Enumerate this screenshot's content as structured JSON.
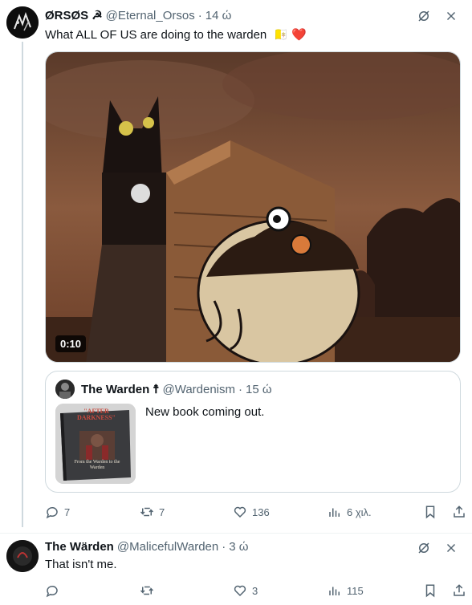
{
  "tweet1": {
    "display_name": "ØRSØS",
    "name_suffix": "☭",
    "handle": "@Eternal_Orsos",
    "separator": "·",
    "time": "14 ώ",
    "text": "What ALL OF US are doing to the warden",
    "emoji": "🇻🇦 ❤️",
    "media": {
      "duration": "0:10"
    },
    "quote": {
      "display_name": "The Warden",
      "name_suffix": "☨",
      "handle": "@Wardenism",
      "separator": "·",
      "time": "15 ώ",
      "text": "New book coming out.",
      "book_title": "\"AFTER DARKNESS\"",
      "book_subtitle": "From the Warden to the Warden"
    },
    "actions": {
      "replies": "7",
      "reposts": "7",
      "likes": "136",
      "views": "6 χιλ."
    }
  },
  "tweet2": {
    "display_name": "The Wärden",
    "handle": "@MalicefulWarden",
    "separator": "·",
    "time": "3 ώ",
    "text": "That isn't me.",
    "actions": {
      "replies": "",
      "reposts": "",
      "likes": "3",
      "views": "115"
    }
  },
  "colors": {
    "text_primary": "#0f1419",
    "text_secondary": "#536471",
    "border": "#cfd9de",
    "heart_red": "#e0245e"
  }
}
